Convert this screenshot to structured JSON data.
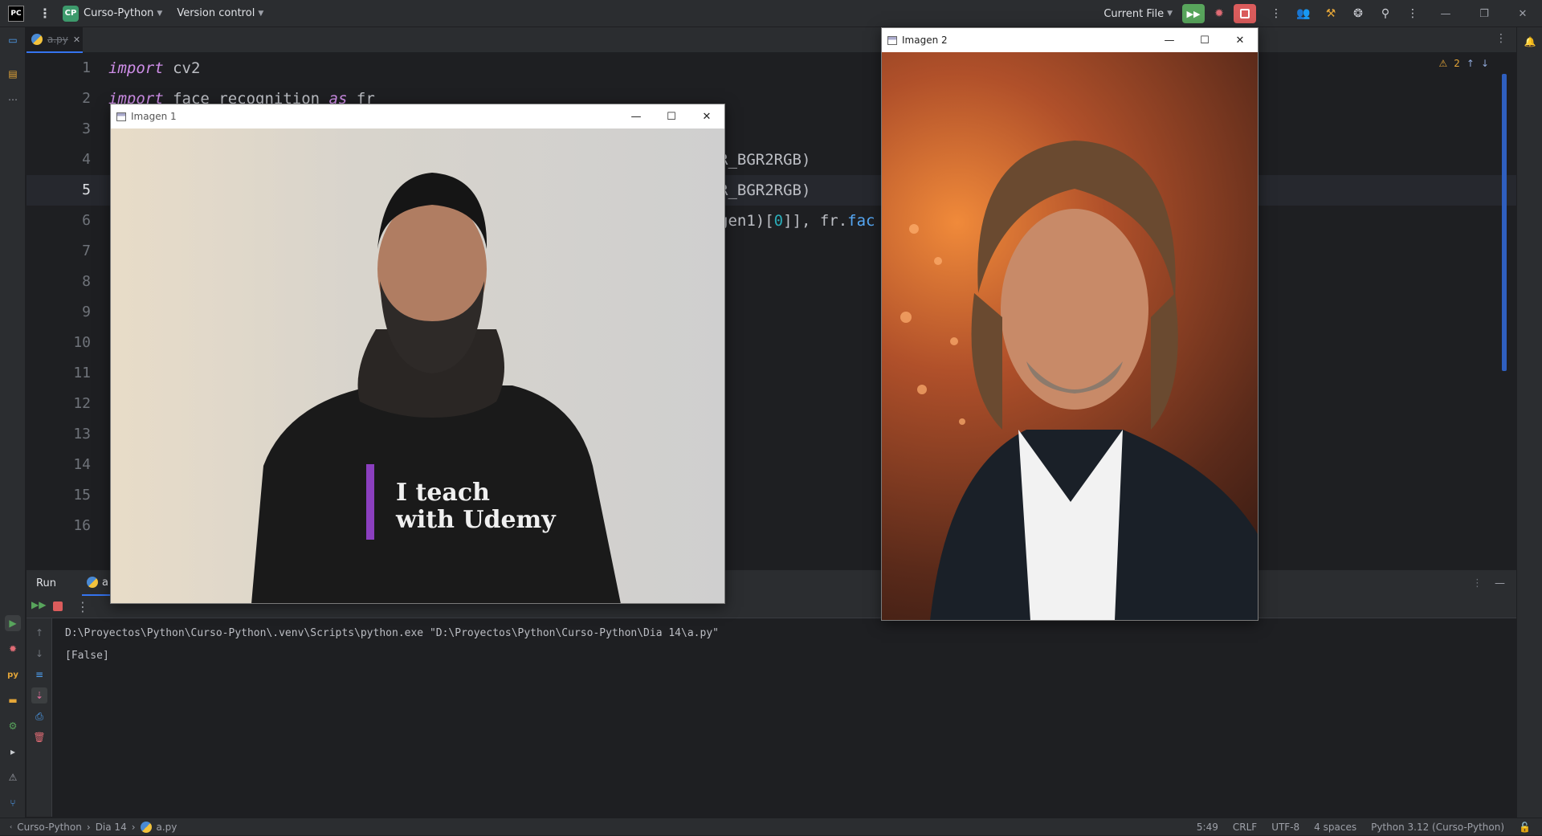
{
  "topbar": {
    "logo_text": "PC",
    "project_badge": "CP",
    "project_name": "Curso-Python",
    "version_control": "Version control",
    "run_config": "Current File"
  },
  "tab": {
    "file_name": "a.py"
  },
  "editor": {
    "line_numbers": [
      "1",
      "2",
      "3",
      "4",
      "5",
      "6",
      "7",
      "8",
      "9",
      "10",
      "11",
      "12",
      "13",
      "14",
      "15",
      "16"
    ],
    "current_line": "5",
    "warnings_count": "2",
    "visible_code": {
      "line1_kw": "import",
      "line1_rest": " cv2",
      "line2_kw": "import",
      "line2_mid": " face_recognition ",
      "line2_as": "as",
      "line2_rest": " fr",
      "line4_tail": "R_BGR2RGB)",
      "line5_tail": "R_BGR2RGB)",
      "line6_a": "gen1)[",
      "line6_num": "0",
      "line6_b": "]], fr.",
      "line6_fn": "fac"
    }
  },
  "run_panel": {
    "tab_label": "Run",
    "config_tab": "a",
    "output_lines": [
      "D:\\Proyectos\\Python\\Curso-Python\\.venv\\Scripts\\python.exe \"D:\\Proyectos\\Python\\Curso-Python\\Dia 14\\a.py\"",
      "[False]"
    ]
  },
  "statusbar": {
    "crumb_project": "Curso-Python",
    "crumb_folder": "Dia 14",
    "crumb_file": "a.py",
    "position": "5:49",
    "line_sep": "CRLF",
    "encoding": "UTF-8",
    "indent": "4 spaces",
    "interpreter": "Python 3.12 (Curso-Python)"
  },
  "windows": {
    "img1_title": "Imagen 1",
    "img2_title": "Imagen 2",
    "tshirt_line1": "I teach",
    "tshirt_line2": "with Udemy"
  }
}
